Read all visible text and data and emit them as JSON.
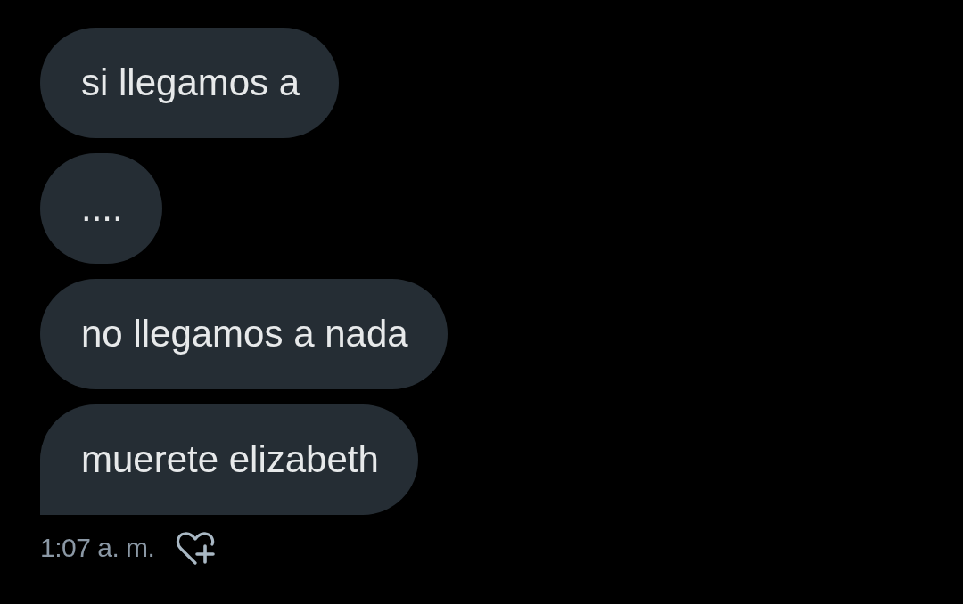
{
  "messages": [
    {
      "text": "si llegamos a",
      "tail": false
    },
    {
      "text": "....",
      "tail": false
    },
    {
      "text": "no llegamos a nada",
      "tail": false
    },
    {
      "text": "muerete elizabeth",
      "tail": true
    }
  ],
  "footer": {
    "time": "1:07 a. m."
  }
}
